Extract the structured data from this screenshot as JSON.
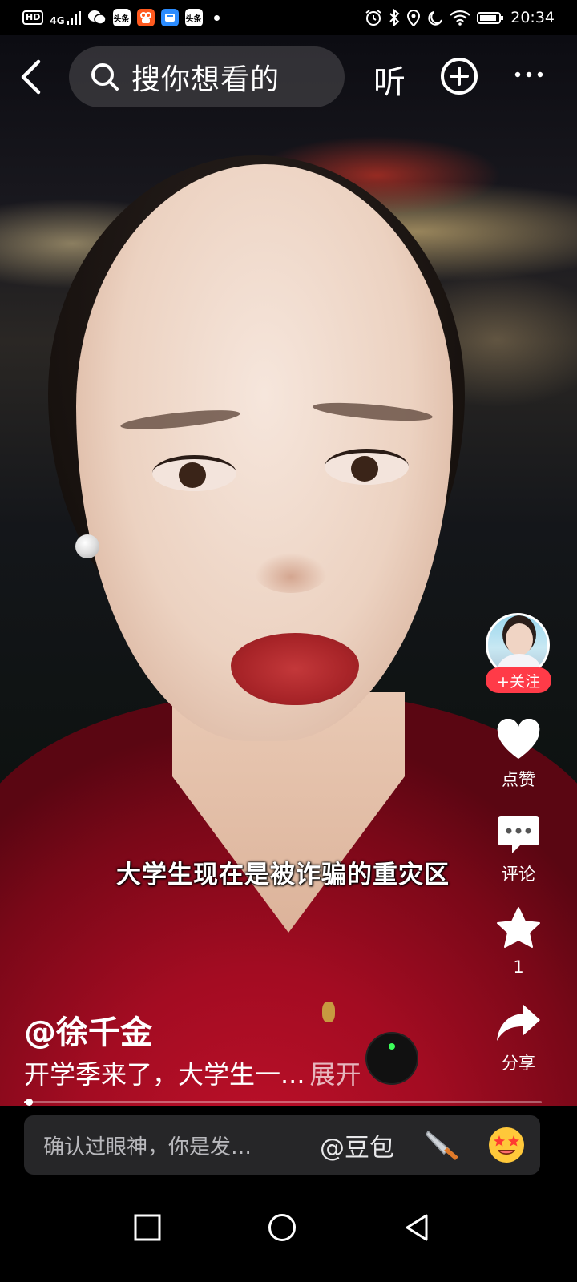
{
  "status_bar": {
    "hd_badge": "HD",
    "network": "4G",
    "app_badges": [
      "头条",
      "头条"
    ],
    "time": "20:34"
  },
  "top_bar": {
    "search_placeholder": "搜你想看的",
    "listen_label": "听"
  },
  "rail": {
    "follow_label": "+关注",
    "like_label": "点赞",
    "comment_label": "评论",
    "favorite_count": "1",
    "share_label": "分享"
  },
  "video": {
    "subtitle": "大学生现在是被诈骗的重灾区",
    "author": "@徐千金",
    "description": "开学季来了，大学生一...",
    "expand_label": "展开",
    "progress": 0.01
  },
  "comment_bar": {
    "placeholder": "确认过眼神，你是发…",
    "mention": "@豆包"
  },
  "colors": {
    "follow_red": "#ff3b48",
    "shirt_red": "#c0102a",
    "comment_bar_bg": "#262628"
  },
  "icons": [
    "back-icon",
    "search-icon",
    "plus-circle-icon",
    "more-icon",
    "heart-icon",
    "comment-icon",
    "star-icon",
    "share-icon",
    "knife-icon",
    "star-eyes-emoji-icon",
    "square-nav-icon",
    "circle-nav-icon",
    "triangle-back-nav-icon"
  ]
}
